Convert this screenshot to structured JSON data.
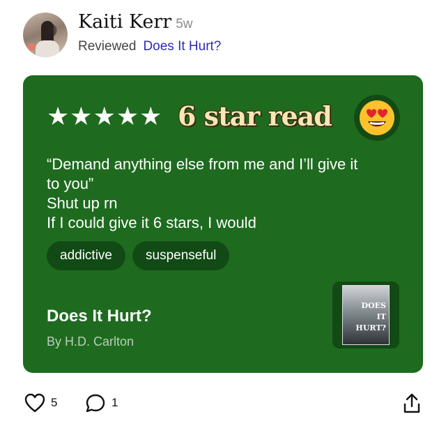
{
  "user": {
    "name": "Kaiti Kerr",
    "time": "5w"
  },
  "reviewed": {
    "label": "Reviewed",
    "book_link": "Does It Hurt?"
  },
  "review": {
    "stars": 5,
    "headline": "6 star read",
    "emoji": "😍",
    "lines": [
      "“Demand anything else from me and I’ll give it",
      "to you”",
      "Shut up rn",
      "If I could give it 6 stars, I would"
    ],
    "tags": [
      "addictive",
      "suspenseful"
    ]
  },
  "book": {
    "title": "Does It Hurt?",
    "author": "By H.D. Carlton",
    "cover_lines": [
      "DOES",
      "IT",
      "HURT?"
    ]
  },
  "actions": {
    "likes": "5",
    "comments": "1"
  },
  "colors": {
    "card": "#1e6b1f",
    "tag_bg": "#124a15",
    "link": "#2b2bb0"
  }
}
